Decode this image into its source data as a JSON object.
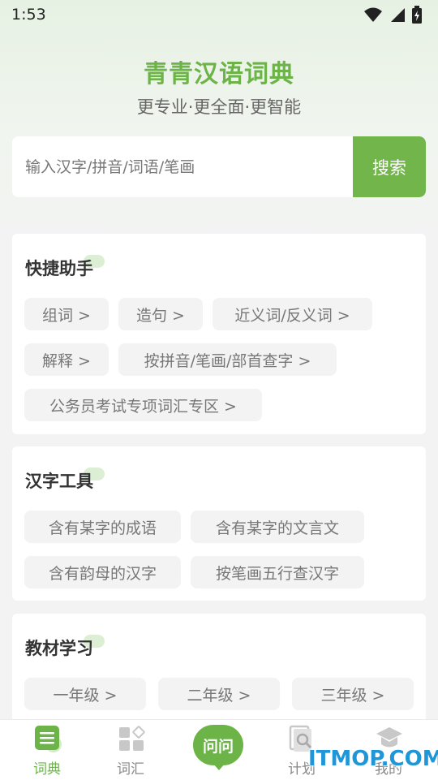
{
  "status": {
    "time": "1:53"
  },
  "hero": {
    "title": "青青汉语词典",
    "subtitle": "更专业·更全面·更智能"
  },
  "search": {
    "placeholder": "输入汉字/拼音/词语/笔画",
    "button": "搜索"
  },
  "quick": {
    "title": "快捷助手",
    "chips": [
      "组词 >",
      "造句 >",
      "近义词/反义词 >",
      "解释 >",
      "按拼音/笔画/部首查字 >",
      "公务员考试专项词汇专区 >"
    ]
  },
  "hanzi": {
    "title": "汉字工具",
    "chips": [
      "含有某字的成语",
      "含有某字的文言文",
      "含有韵母的汉字",
      "按笔画五行查汉字"
    ]
  },
  "textbook": {
    "title": "教材学习",
    "chips": [
      "一年级 >",
      "二年级 >",
      "三年级 >"
    ]
  },
  "nav": {
    "tabs": [
      "词典",
      "词汇",
      "计划",
      "我的"
    ],
    "center": "问问",
    "active_color": "#6cb447"
  },
  "watermark": "ITMOP.COM"
}
